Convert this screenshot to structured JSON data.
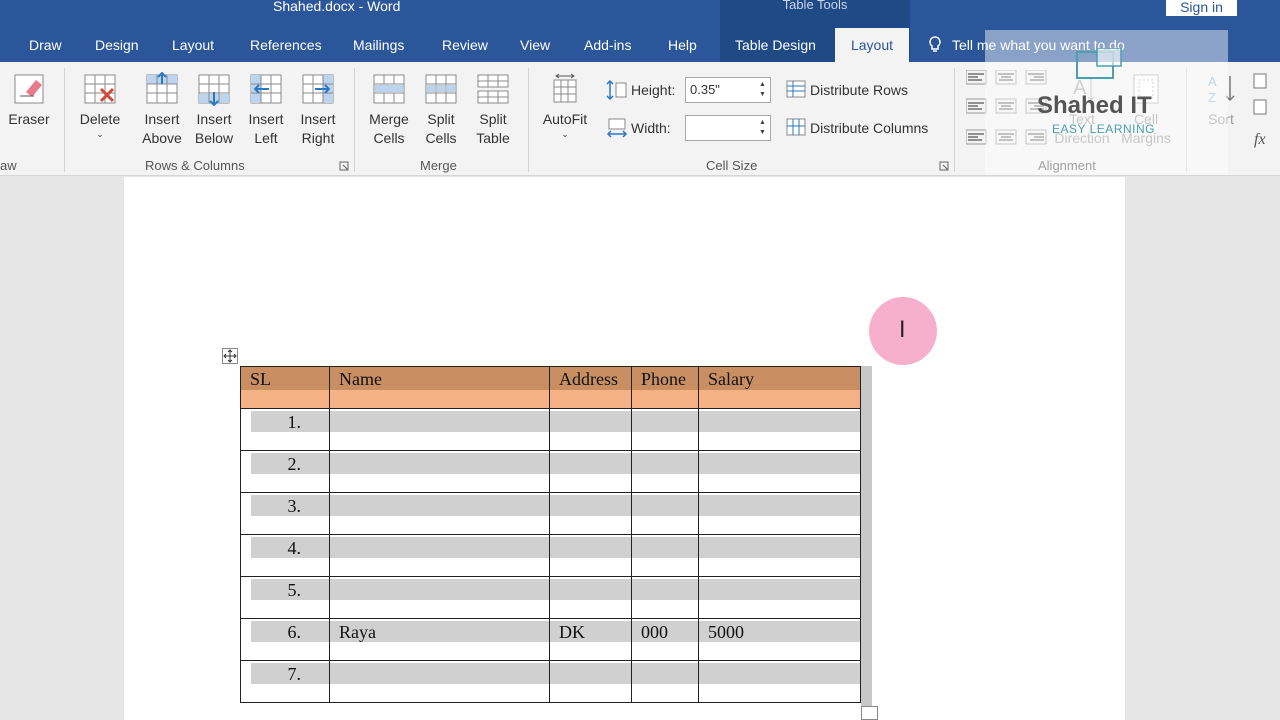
{
  "window": {
    "doc_title": "Shahed.docx  -  Word",
    "context_title": "Table Tools",
    "sign_in": "Sign in"
  },
  "tabs": {
    "draw": "Draw",
    "design": "Design",
    "layout": "Layout",
    "references": "References",
    "mailings": "Mailings",
    "review": "Review",
    "view": "View",
    "addins": "Add-ins",
    "help": "Help",
    "table_design": "Table Design",
    "table_layout": "Layout",
    "tell_me": "Tell me what you want to do"
  },
  "ribbon": {
    "eraser": "Eraser",
    "draw_group": "aw",
    "delete": "Delete",
    "insert_above_1": "Insert",
    "insert_above_2": "Above",
    "insert_below_1": "Insert",
    "insert_below_2": "Below",
    "insert_left_1": "Insert",
    "insert_left_2": "Left",
    "insert_right_1": "Insert",
    "insert_right_2": "Right",
    "rows_columns_group": "Rows & Columns",
    "merge_cells_1": "Merge",
    "merge_cells_2": "Cells",
    "split_cells_1": "Split",
    "split_cells_2": "Cells",
    "split_table_1": "Split",
    "split_table_2": "Table",
    "merge_group": "Merge",
    "autofit": "AutoFit",
    "height_label": "Height:",
    "height_value": "0.35\"",
    "width_label": "Width:",
    "width_value": "",
    "distribute_rows": "Distribute Rows",
    "distribute_columns": "Distribute Columns",
    "cell_size_group": "Cell Size",
    "text_direction_1": "Text",
    "text_direction_2": "Direction",
    "cell_margins_1": "Cell",
    "cell_margins_2": "Margins",
    "alignment_group": "Alignment",
    "sort": "Sort"
  },
  "watermark": {
    "brand": "Shahed IT",
    "tagline": "EASY LEARNING"
  },
  "table": {
    "headers": [
      "SL",
      "Name",
      "Address",
      "Phone",
      "Salary"
    ],
    "rows": [
      [
        "1.",
        "",
        "",
        "",
        ""
      ],
      [
        "2.",
        "",
        "",
        "",
        ""
      ],
      [
        "3.",
        "",
        "",
        "",
        ""
      ],
      [
        "4.",
        "",
        "",
        "",
        ""
      ],
      [
        "5.",
        "",
        "",
        "",
        ""
      ],
      [
        "6.",
        "Raya",
        "DK",
        "000",
        "5000"
      ],
      [
        "7.",
        "",
        "",
        "",
        ""
      ]
    ]
  },
  "colors": {
    "word_blue": "#2b579a",
    "context_blue": "#1f4a86",
    "header_fill": "#f4b183",
    "header_band": "#c98f63",
    "row_band": "#d0d0d0"
  }
}
